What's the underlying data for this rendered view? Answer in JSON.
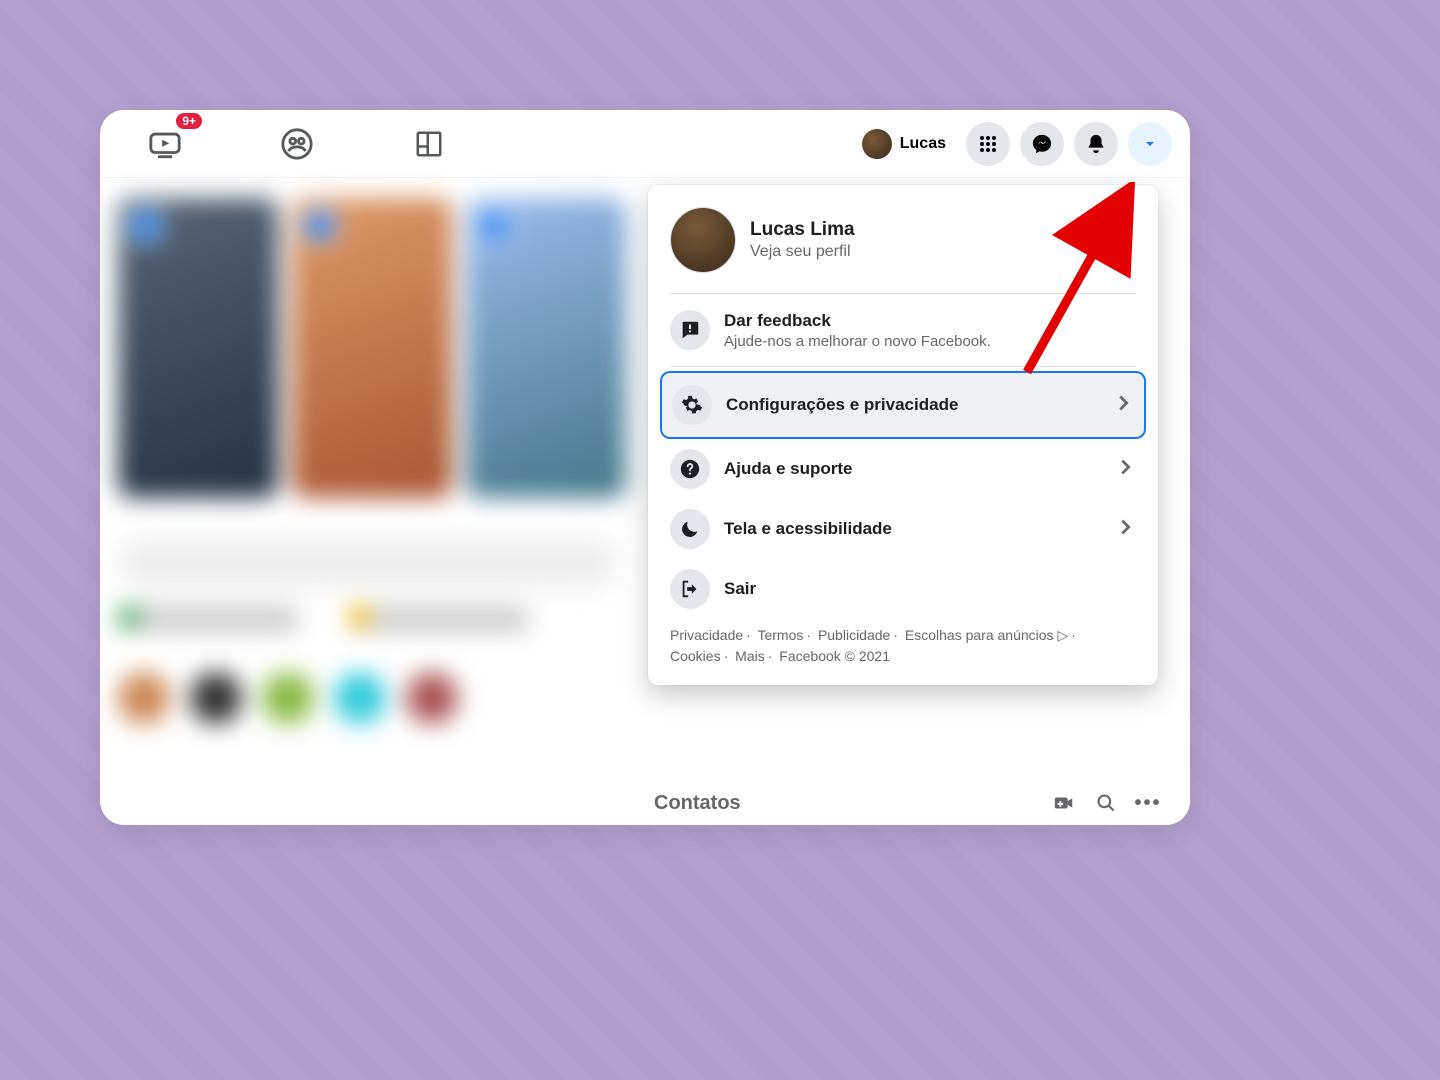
{
  "topbar": {
    "watch_badge": "9+",
    "profile_name_short": "Lucas"
  },
  "dropdown": {
    "profile": {
      "name": "Lucas Lima",
      "subtitle": "Veja seu perfil"
    },
    "feedback": {
      "title": "Dar feedback",
      "subtitle": "Ajude-nos a melhorar o novo Facebook."
    },
    "items": [
      {
        "label": "Configurações e privacidade",
        "icon": "gear",
        "chevron": true,
        "highlight": true
      },
      {
        "label": "Ajuda e suporte",
        "icon": "help",
        "chevron": true
      },
      {
        "label": "Tela e acessibilidade",
        "icon": "moon",
        "chevron": true
      },
      {
        "label": "Sair",
        "icon": "logout",
        "chevron": false
      }
    ],
    "footer": {
      "privacy": "Privacidade",
      "terms": "Termos",
      "ads": "Publicidade",
      "adchoices": "Escolhas para anúncios",
      "cookies": "Cookies",
      "more": "Mais",
      "copyright": "Facebook © 2021"
    }
  },
  "contacts_title": "Contatos"
}
